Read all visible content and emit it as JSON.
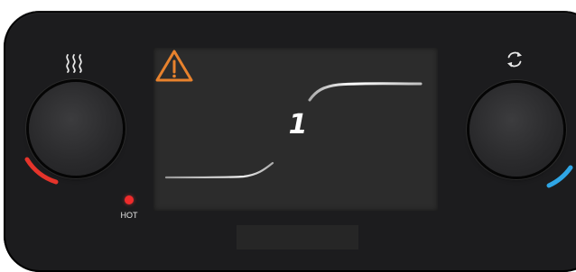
{
  "display": {
    "step_number": "1",
    "warning_icon": "warning-triangle-icon",
    "warning_color": "#e8822d"
  },
  "controls": {
    "heat_knob": {
      "icon": "heat-waves-icon",
      "indicator_color": "#e5342b"
    },
    "rotate_knob": {
      "icon": "rotate-arrows-icon",
      "indicator_color": "#2fa6e6"
    },
    "hot_indicator": {
      "label": "HOT",
      "color": "#ef2b2b"
    }
  },
  "colors": {
    "panel": "#1c1c1e",
    "screen": "#2c2c2c"
  }
}
